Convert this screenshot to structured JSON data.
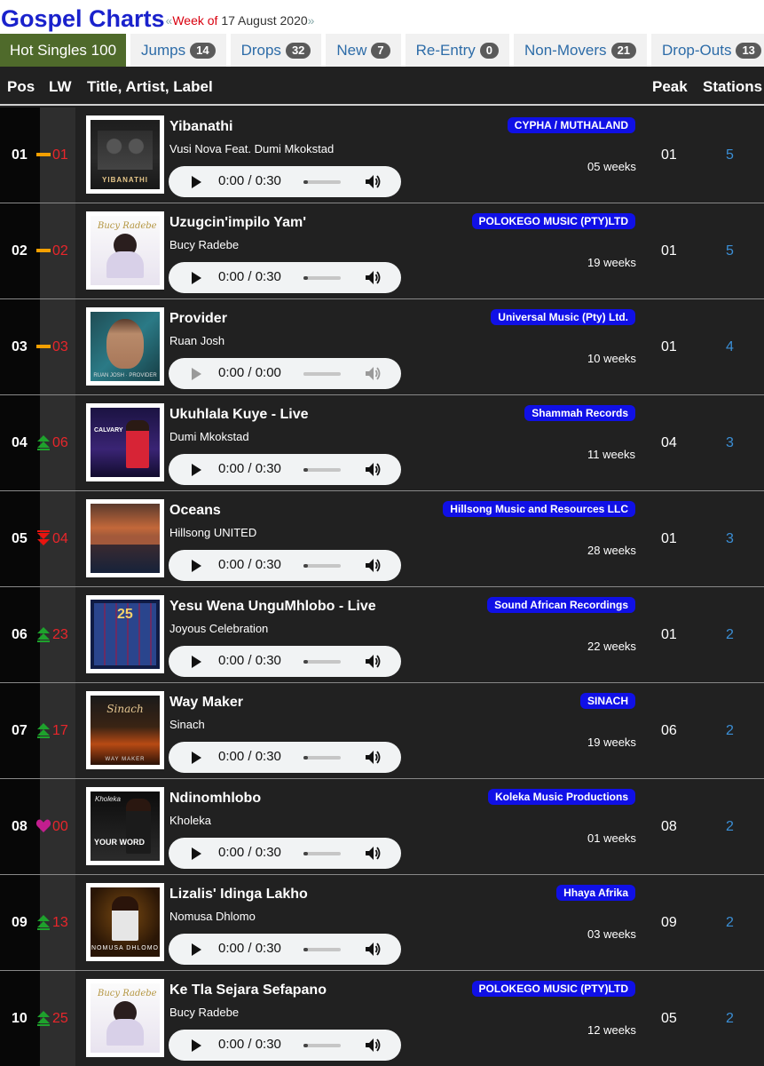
{
  "header": {
    "title": "Gospel Charts",
    "open_quote": "«",
    "week_of": "Week of",
    "date": "17 August 2020",
    "close_quote": "»"
  },
  "tabs": [
    {
      "label": "Hot Singles 100",
      "count": ""
    },
    {
      "label": "Jumps",
      "count": "14"
    },
    {
      "label": "Drops",
      "count": "32"
    },
    {
      "label": "New",
      "count": "7"
    },
    {
      "label": "Re-Entry",
      "count": "0"
    },
    {
      "label": "Non-Movers",
      "count": "21"
    },
    {
      "label": "Drop-Outs",
      "count": "13"
    }
  ],
  "columns": {
    "pos": "Pos",
    "lw": "LW",
    "title": "Title, Artist, Label",
    "peak": "Peak",
    "stations": "Stations"
  },
  "colors": {
    "title_blue": "#1a22cc",
    "active_tab": "#4f6a2b",
    "label_blue": "#1010e6",
    "lw_red": "#e8262b",
    "station_blue": "#3b8fd6",
    "same": "#f5a000",
    "up": "#1ea22c",
    "down": "#e8140f",
    "new": "#c21e8e"
  },
  "rows": [
    {
      "pos": "01",
      "lw": "01",
      "move": "same",
      "song": "Yibanathi",
      "artist": "Vusi Nova Feat. Dumi Mkokstad",
      "label": "CYPHA / MUTHALAND",
      "weeks": "05 weeks",
      "peak": "01",
      "stations": "5",
      "time": "0:00 / 0:30",
      "art_icon": "album-art-yibanathi"
    },
    {
      "pos": "02",
      "lw": "02",
      "move": "same",
      "song": "Uzugcin'impilo Yam'",
      "artist": "Bucy Radebe",
      "label": "POLOKEGO MUSIC (PTY)LTD",
      "weeks": "19 weeks",
      "peak": "01",
      "stations": "5",
      "time": "0:00 / 0:30",
      "art_icon": "album-art-spiritual-encounter"
    },
    {
      "pos": "03",
      "lw": "03",
      "move": "same",
      "song": "Provider",
      "artist": "Ruan Josh",
      "label": "Universal Music (Pty) Ltd.",
      "weeks": "10 weeks",
      "peak": "01",
      "stations": "4",
      "time": "0:00 / 0:00",
      "art_icon": "album-art-provider"
    },
    {
      "pos": "04",
      "lw": "06",
      "move": "up",
      "song": "Ukuhlala Kuye - Live",
      "artist": "Dumi Mkokstad",
      "label": "Shammah Records",
      "weeks": "11 weeks",
      "peak": "04",
      "stations": "3",
      "time": "0:00 / 0:30",
      "art_icon": "album-art-calvary"
    },
    {
      "pos": "05",
      "lw": "04",
      "move": "down",
      "song": "Oceans",
      "artist": "Hillsong UNITED",
      "label": "Hillsong Music and Resources LLC",
      "weeks": "28 weeks",
      "peak": "01",
      "stations": "3",
      "time": "0:00 / 0:30",
      "art_icon": "album-art-oceans"
    },
    {
      "pos": "06",
      "lw": "23",
      "move": "up",
      "song": "Yesu Wena UnguMhlobo - Live",
      "artist": "Joyous Celebration",
      "label": "Sound African Recordings",
      "weeks": "22 weeks",
      "peak": "01",
      "stations": "2",
      "time": "0:00 / 0:30",
      "art_icon": "album-art-joyous-25"
    },
    {
      "pos": "07",
      "lw": "17",
      "move": "up",
      "song": "Way Maker",
      "artist": "Sinach",
      "label": "SINACH",
      "weeks": "19 weeks",
      "peak": "06",
      "stations": "2",
      "time": "0:00 / 0:30",
      "art_icon": "album-art-way-maker"
    },
    {
      "pos": "08",
      "lw": "00",
      "move": "new",
      "song": "Ndinomhlobo",
      "artist": "Kholeka",
      "label": "Koleka Music Productions",
      "weeks": "01 weeks",
      "peak": "08",
      "stations": "2",
      "time": "0:00 / 0:30",
      "art_icon": "album-art-your-word"
    },
    {
      "pos": "09",
      "lw": "13",
      "move": "up",
      "song": "Lizalis' Idinga Lakho",
      "artist": "Nomusa Dhlomo",
      "label": "Hhaya Afrika",
      "weeks": "03 weeks",
      "peak": "09",
      "stations": "2",
      "time": "0:00 / 0:30",
      "art_icon": "album-art-nomusa-dhlomo"
    },
    {
      "pos": "10",
      "lw": "25",
      "move": "up",
      "song": "Ke Tla Sejara Sefapano",
      "artist": "Bucy Radebe",
      "label": "POLOKEGO MUSIC (PTY)LTD",
      "weeks": "12 weeks",
      "peak": "05",
      "stations": "2",
      "time": "0:00 / 0:30",
      "art_icon": "album-art-spiritual-encounter"
    }
  ],
  "art_text": {
    "a0": "YIBANATHI",
    "a3": "CALVARY",
    "a6": "Sinach",
    "a6b": "WAY MAKER",
    "a7": "Kholeka",
    "a7b": "YOUR WORD",
    "a8": "NOMUSA DHLOMO",
    "a5": "25"
  }
}
